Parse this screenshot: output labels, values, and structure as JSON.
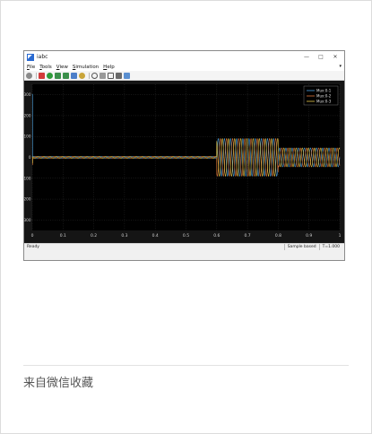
{
  "window": {
    "title": "iabc"
  },
  "menu": [
    {
      "u": "F",
      "rest": "ile"
    },
    {
      "u": "T",
      "rest": "ools"
    },
    {
      "u": "V",
      "rest": "iew"
    },
    {
      "u": "S",
      "rest": "imulation"
    },
    {
      "u": "H",
      "rest": "elp"
    }
  ],
  "toolbar_icons": [
    "settings-icon",
    "stop-icon",
    "run-icon",
    "step-back-icon",
    "step-forward-icon",
    "pause-icon",
    "record-icon",
    "zoom-icon",
    "zoom-x-icon",
    "fit-icon",
    "cursor-icon",
    "measure-icon"
  ],
  "chart_data": {
    "type": "line",
    "xlim": [
      0,
      1
    ],
    "ylim": [
      -350,
      350
    ],
    "x_ticks": [
      "0",
      "0.1",
      "0.2",
      "0.3",
      "0.4",
      "0.5",
      "0.6",
      "0.7",
      "0.8",
      "0.9",
      "1"
    ],
    "y_ticks": [
      "300",
      "200",
      "100",
      "0",
      "-100",
      "-200",
      "-300"
    ],
    "grid": true,
    "legend_position": "top-right",
    "series": [
      {
        "name": "Mux:0-1",
        "color": "#4fa3e0",
        "phase_deg": 0
      },
      {
        "name": "Mux:0-2",
        "color": "#e07a3c",
        "phase_deg": -120
      },
      {
        "name": "Mux:0-3",
        "color": "#e8c84a",
        "phase_deg": 120
      }
    ],
    "segments": [
      {
        "t_start": 0.0,
        "t_end": 0.6,
        "amplitude": 5
      },
      {
        "t_start": 0.6,
        "t_end": 0.8,
        "amplitude": 90
      },
      {
        "t_start": 0.8,
        "t_end": 1.0,
        "amplitude": 45
      }
    ],
    "frequency_hz": 50,
    "start_spike": 300
  },
  "status": {
    "left": "Ready",
    "mode": "Sample based",
    "time": "T=1.000"
  },
  "footer": {
    "text": "来自微信收藏"
  }
}
